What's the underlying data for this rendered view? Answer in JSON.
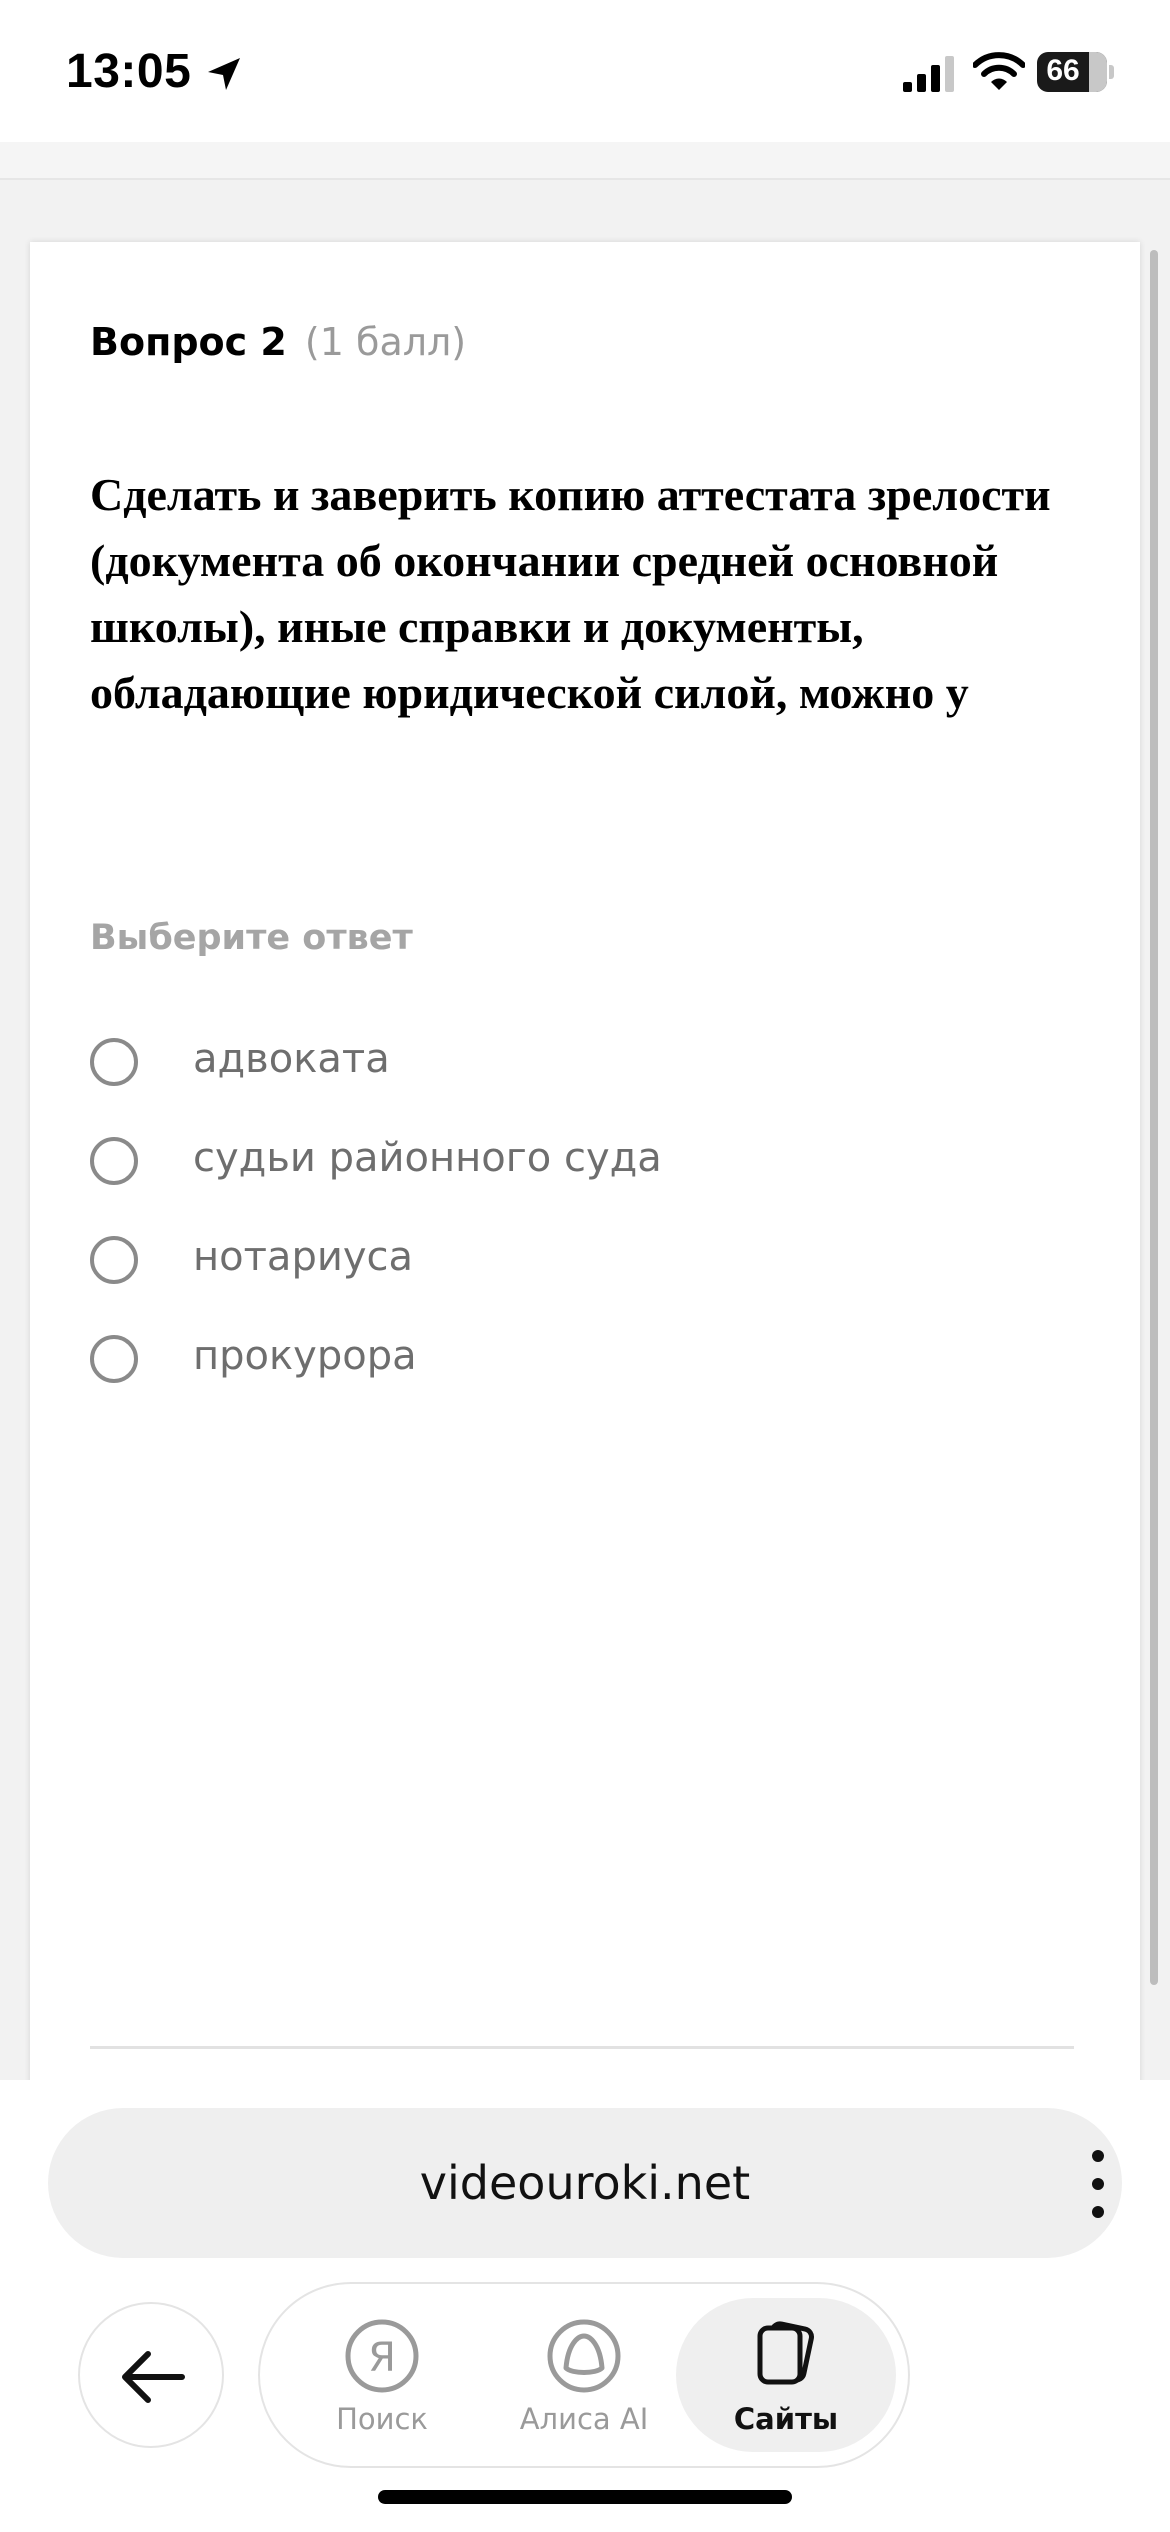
{
  "status_bar": {
    "time": "13:05",
    "battery": "66",
    "icons": [
      "location-arrow-icon",
      "cellular-signal-icon",
      "wifi-icon",
      "battery-icon"
    ]
  },
  "question": {
    "number_label": "Вопрос 2",
    "points_label": "(1 балл)",
    "text": "Сделать и заверить копию аттестата зрелости (документа об окончании средней основной школы), иные справки и документы, обладающие юридической силой, можно у",
    "prompt": "Выберите ответ",
    "options": [
      {
        "label": "адвоката",
        "selected": false
      },
      {
        "label": "судьи районного суда",
        "selected": false
      },
      {
        "label": "нотариуса",
        "selected": false
      },
      {
        "label": "прокурора",
        "selected": false
      }
    ]
  },
  "browser": {
    "url": "videouroki.net",
    "menu_icon": "more-vertical-icon",
    "back_icon": "arrow-left-icon",
    "tabs": [
      {
        "label": "Поиск",
        "icon": "yandex-search-icon",
        "active": false
      },
      {
        "label": "Алиса AI",
        "icon": "alice-icon",
        "active": false
      },
      {
        "label": "Сайты",
        "icon": "sites-cards-icon",
        "active": true
      }
    ]
  },
  "colors": {
    "background": "#f2f2f2",
    "card": "#ffffff",
    "muted_text": "#9a9a9a",
    "option_text": "#6e6e6e",
    "radio_border": "#8a8a8a"
  }
}
